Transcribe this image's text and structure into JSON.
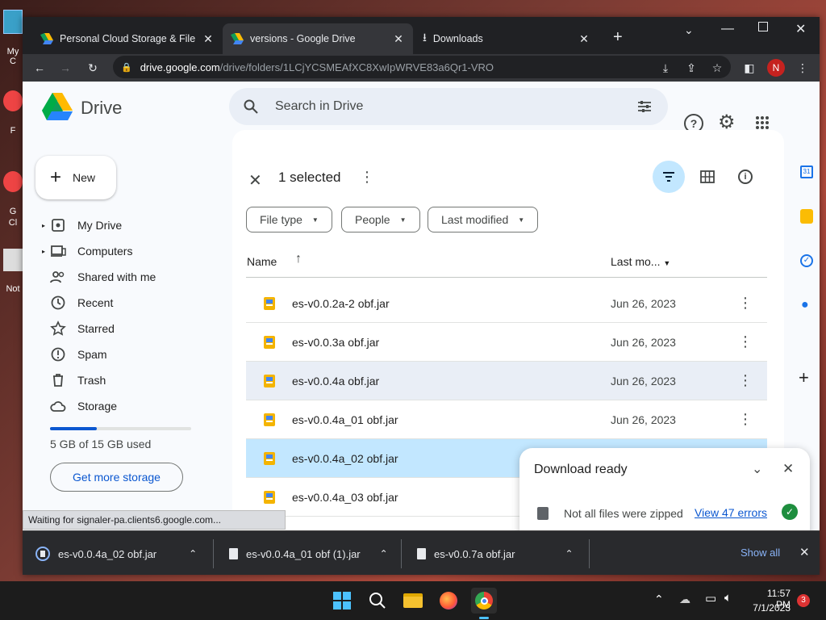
{
  "desktop": {
    "icons": [
      "My C",
      "F",
      "G",
      "Cl",
      "Not"
    ]
  },
  "browser": {
    "tabs": [
      {
        "title": "Personal Cloud Storage & File Sh",
        "active": false
      },
      {
        "title": "versions - Google Drive",
        "active": true
      },
      {
        "title": "Downloads",
        "active": false
      }
    ],
    "url_host": "drive.google.com",
    "url_path": "/drive/folders/1LCjYCSMEAfXC8XwIpWRVE83a6Qr1-VRO",
    "profile_initial": "N"
  },
  "drive": {
    "title": "Drive",
    "search_placeholder": "Search in Drive",
    "new_label": "New",
    "nav": [
      "My Drive",
      "Computers",
      "Shared with me",
      "Recent",
      "Starred",
      "Spam",
      "Trash",
      "Storage"
    ],
    "storage_text": "5 GB of 15 GB used",
    "storage_fraction": 0.33,
    "get_storage_label": "Get more storage",
    "selection_text": "1 selected",
    "filters": [
      "File type",
      "People",
      "Last modified"
    ],
    "col_name": "Name",
    "col_modified": "Last mo...",
    "files": [
      {
        "name": "es-v0.0.2a-2 obf.jar",
        "date": "Jun 26, 2023",
        "state": "normal"
      },
      {
        "name": "es-v0.0.3a obf.jar",
        "date": "Jun 26, 2023",
        "state": "normal"
      },
      {
        "name": "es-v0.0.4a obf.jar",
        "date": "Jun 26, 2023",
        "state": "hover"
      },
      {
        "name": "es-v0.0.4a_01 obf.jar",
        "date": "Jun 26, 2023",
        "state": "normal"
      },
      {
        "name": "es-v0.0.4a_02 obf.jar",
        "date": "",
        "state": "selected"
      },
      {
        "name": "es-v0.0.4a_03 obf.jar",
        "date": "",
        "state": "normal"
      }
    ],
    "download_panel": {
      "title": "Download ready",
      "message": "Not all files were zipped",
      "link": "View 47 errors"
    }
  },
  "status_bar": "Waiting for signaler-pa.clients6.google.com...",
  "downloads_bar": {
    "items": [
      "es-v0.0.4a_02 obf.jar",
      "es-v0.0.4a_01 obf (1).jar",
      "es-v0.0.7a obf.jar"
    ],
    "show_all": "Show all"
  },
  "taskbar": {
    "time": "11:57 PM",
    "date": "7/1/2023",
    "badge": "3"
  },
  "colors": {
    "selected_row": "#c2e7ff",
    "hover_row": "#e9eef6",
    "accent": "#0b57d0",
    "avatar": "#b3261e"
  }
}
